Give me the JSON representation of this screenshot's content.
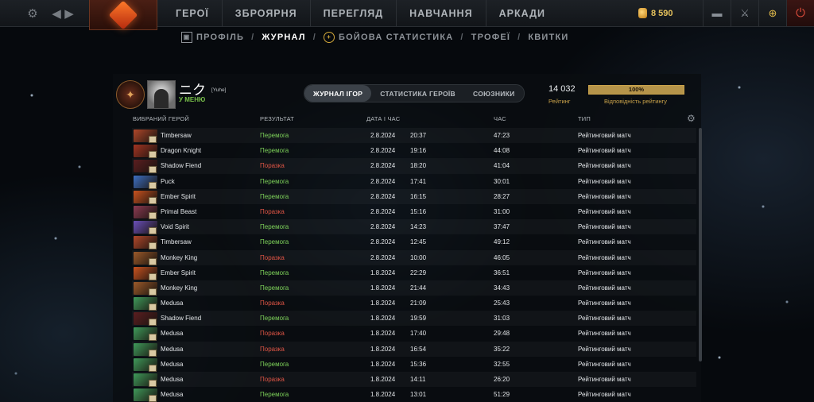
{
  "nav": {
    "items": [
      "ГЕРОЇ",
      "ЗБРОЯРНЯ",
      "ПЕРЕГЛЯД",
      "НАВЧАННЯ",
      "АРКАДИ"
    ],
    "currency": "8 590"
  },
  "subnav": {
    "items": [
      "ПРОФІЛЬ",
      "ЖУРНАЛ",
      "БОЙОВА СТАТИСТИКА",
      "ТРОФЕЇ",
      "КВИТКИ"
    ]
  },
  "player": {
    "name": "ニク",
    "tag": "[Yuhe]",
    "status": "У МЕНЮ"
  },
  "tabs": [
    "ЖУРНАЛ ІГОР",
    "СТАТИСТИКА ГЕРОЇВ",
    "СОЮЗНИКИ"
  ],
  "rating": {
    "value": "14 032",
    "label": "Рейтинг",
    "confidence_text": "100%",
    "confidence": 1.0,
    "confidence_label": "Відповідність рейтингу"
  },
  "table": {
    "headers": [
      "ВИБРАНИЙ ГЕРОЙ",
      "РЕЗУЛЬТАТ",
      "ДАТА І ЧАС",
      "ЧАС",
      "ТИП"
    ],
    "rows": [
      {
        "hero": "Timbersaw",
        "result": "Перемога",
        "win": true,
        "date": "2.8.2024",
        "time": "20:37",
        "duration": "47:23",
        "type": "Рейтинговий матч",
        "color": "#b0472a"
      },
      {
        "hero": "Dragon Knight",
        "result": "Перемога",
        "win": true,
        "date": "2.8.2024",
        "time": "19:16",
        "duration": "44:08",
        "type": "Рейтинговий матч",
        "color": "#a33422"
      },
      {
        "hero": "Shadow Fiend",
        "result": "Поразка",
        "win": false,
        "date": "2.8.2024",
        "time": "18:20",
        "duration": "41:04",
        "type": "Рейтинговий матч",
        "color": "#5b1e20"
      },
      {
        "hero": "Puck",
        "result": "Перемога",
        "win": true,
        "date": "2.8.2024",
        "time": "17:41",
        "duration": "30:01",
        "type": "Рейтинговий матч",
        "color": "#3d6fc2"
      },
      {
        "hero": "Ember Spirit",
        "result": "Перемога",
        "win": true,
        "date": "2.8.2024",
        "time": "16:15",
        "duration": "28:27",
        "type": "Рейтинговий матч",
        "color": "#c9521f"
      },
      {
        "hero": "Primal Beast",
        "result": "Поразка",
        "win": false,
        "date": "2.8.2024",
        "time": "15:16",
        "duration": "31:00",
        "type": "Рейтинговий матч",
        "color": "#8b3a52"
      },
      {
        "hero": "Void Spirit",
        "result": "Перемога",
        "win": true,
        "date": "2.8.2024",
        "time": "14:23",
        "duration": "37:47",
        "type": "Рейтинговий матч",
        "color": "#6a4fb8"
      },
      {
        "hero": "Timbersaw",
        "result": "Перемога",
        "win": true,
        "date": "2.8.2024",
        "time": "12:45",
        "duration": "49:12",
        "type": "Рейтинговий матч",
        "color": "#b0472a"
      },
      {
        "hero": "Monkey King",
        "result": "Поразка",
        "win": false,
        "date": "2.8.2024",
        "time": "10:00",
        "duration": "46:05",
        "type": "Рейтинговий матч",
        "color": "#9c5a2a"
      },
      {
        "hero": "Ember Spirit",
        "result": "Перемога",
        "win": true,
        "date": "1.8.2024",
        "time": "22:29",
        "duration": "36:51",
        "type": "Рейтинговий матч",
        "color": "#c9521f"
      },
      {
        "hero": "Monkey King",
        "result": "Перемога",
        "win": true,
        "date": "1.8.2024",
        "time": "21:44",
        "duration": "34:43",
        "type": "Рейтинговий матч",
        "color": "#9c5a2a"
      },
      {
        "hero": "Medusa",
        "result": "Поразка",
        "win": false,
        "date": "1.8.2024",
        "time": "21:09",
        "duration": "25:43",
        "type": "Рейтинговий матч",
        "color": "#3f9a5a"
      },
      {
        "hero": "Shadow Fiend",
        "result": "Перемога",
        "win": true,
        "date": "1.8.2024",
        "time": "19:59",
        "duration": "31:03",
        "type": "Рейтинговий матч",
        "color": "#5b1e20"
      },
      {
        "hero": "Medusa",
        "result": "Поразка",
        "win": false,
        "date": "1.8.2024",
        "time": "17:40",
        "duration": "29:48",
        "type": "Рейтинговий матч",
        "color": "#3f9a5a"
      },
      {
        "hero": "Medusa",
        "result": "Поразка",
        "win": false,
        "date": "1.8.2024",
        "time": "16:54",
        "duration": "35:22",
        "type": "Рейтинговий матч",
        "color": "#3f9a5a"
      },
      {
        "hero": "Medusa",
        "result": "Перемога",
        "win": true,
        "date": "1.8.2024",
        "time": "15:36",
        "duration": "32:55",
        "type": "Рейтинговий матч",
        "color": "#3f9a5a"
      },
      {
        "hero": "Medusa",
        "result": "Поразка",
        "win": false,
        "date": "1.8.2024",
        "time": "14:11",
        "duration": "26:20",
        "type": "Рейтинговий матч",
        "color": "#3f9a5a"
      },
      {
        "hero": "Medusa",
        "result": "Перемога",
        "win": true,
        "date": "1.8.2024",
        "time": "13:01",
        "duration": "51:29",
        "type": "Рейтинговий матч",
        "color": "#3f9a5a"
      }
    ]
  }
}
